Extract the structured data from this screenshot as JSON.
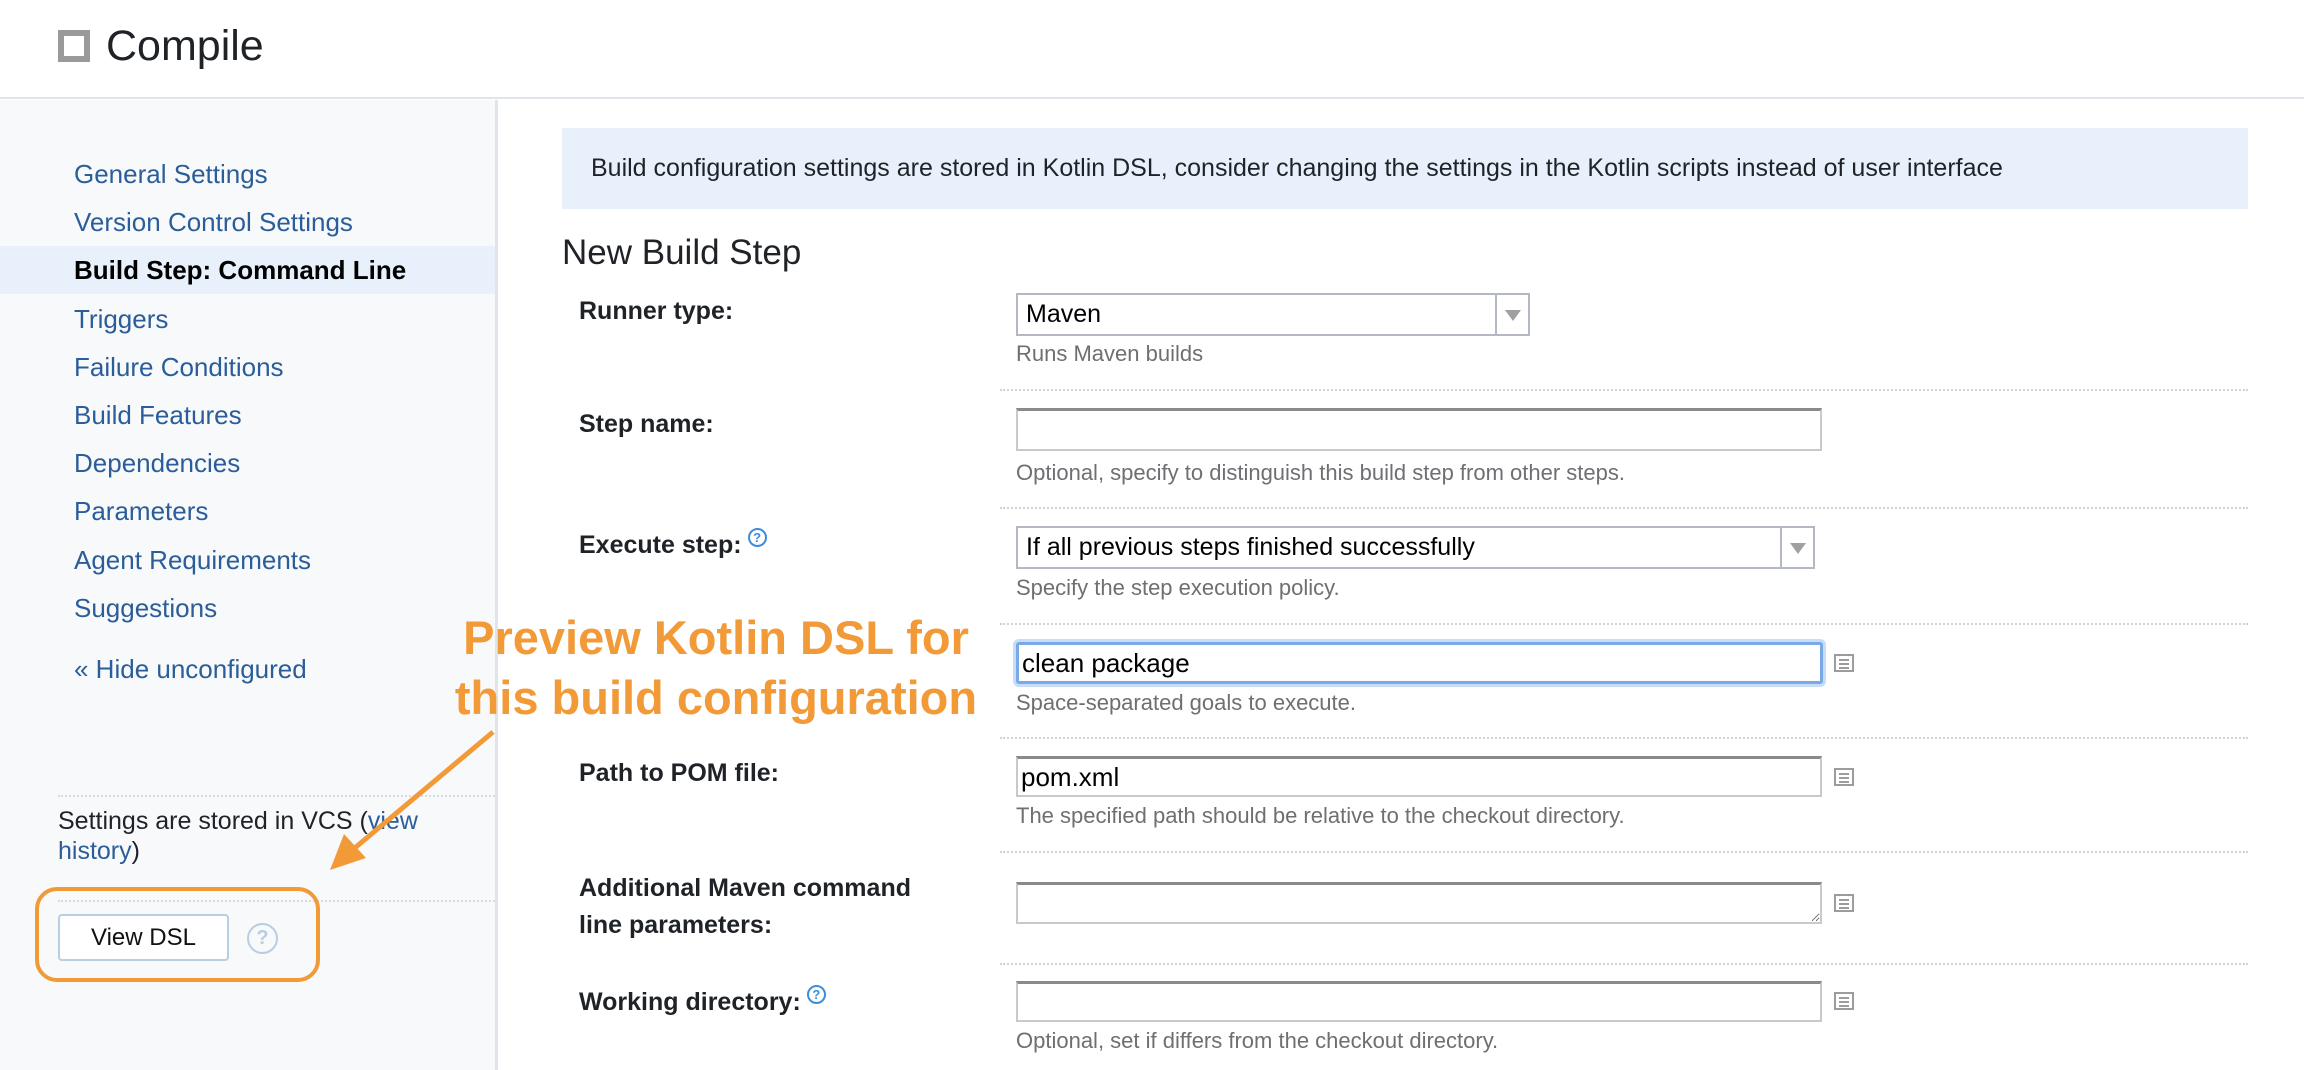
{
  "header": {
    "title": "Compile",
    "icon": "square-outline-icon"
  },
  "sidebar": {
    "items": [
      {
        "label": "General Settings",
        "active": false
      },
      {
        "label": "Version Control Settings",
        "active": false
      },
      {
        "label": "Build Step: Command Line",
        "active": true
      },
      {
        "label": "Triggers",
        "active": false
      },
      {
        "label": "Failure Conditions",
        "active": false
      },
      {
        "label": "Build Features",
        "active": false
      },
      {
        "label": "Dependencies",
        "active": false
      },
      {
        "label": "Parameters",
        "active": false
      },
      {
        "label": "Agent Requirements",
        "active": false
      },
      {
        "label": "Suggestions",
        "active": false
      }
    ],
    "hide_unconfigured": "« Hide unconfigured",
    "vcs_text_prefix": "Settings are stored in VCS (",
    "vcs_link": "view history",
    "vcs_text_suffix": ")",
    "view_dsl_button": "View DSL",
    "help_glyph": "?"
  },
  "main": {
    "banner": "Build configuration settings are stored in Kotlin DSL, consider changing the settings in the Kotlin scripts instead of user interface",
    "section_title": "New Build Step",
    "fields": {
      "runner_type": {
        "label": "Runner type:",
        "value": "Maven",
        "hint": "Runs Maven builds"
      },
      "step_name": {
        "label": "Step name:",
        "value": "",
        "hint": "Optional, specify to distinguish this build step from other steps."
      },
      "execute_step": {
        "label": "Execute step:",
        "value": "If all previous steps finished successfully",
        "hint": "Specify the step execution policy."
      },
      "goals": {
        "value": "clean package",
        "hint": "Space-separated goals to execute."
      },
      "pom_path": {
        "label": "Path to POM file:",
        "value": "pom.xml",
        "hint": "The specified path should be relative to the checkout directory."
      },
      "additional_params": {
        "label_line1": "Additional Maven command",
        "label_line2": "line parameters:",
        "value": ""
      },
      "working_dir": {
        "label": "Working directory:",
        "value": "",
        "hint": "Optional, set if differs from the checkout directory."
      }
    },
    "help_glyph": "?"
  },
  "annotation": {
    "line1": "Preview Kotlin DSL for",
    "line2": "this build configuration",
    "color": "#f29a38"
  },
  "colors": {
    "link": "#2b5d99",
    "active_bg": "#e8f1fb",
    "banner_bg": "#e8f1fb",
    "focus": "#7aa9e8",
    "help_blue": "#3b8de0"
  }
}
